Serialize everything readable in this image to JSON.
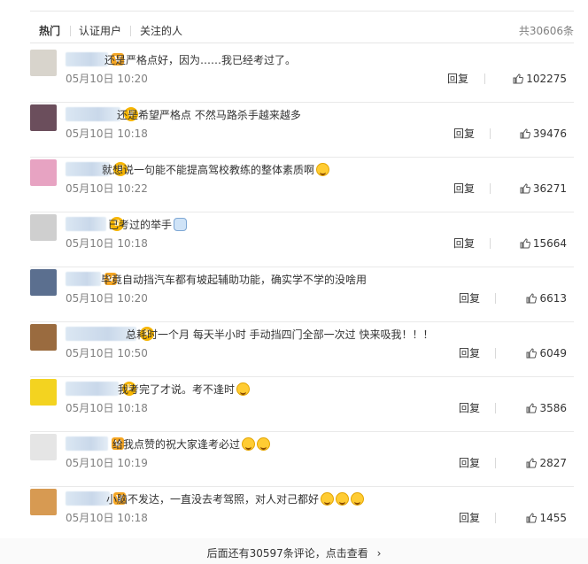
{
  "tabs": {
    "items": [
      {
        "label": "热门",
        "active": true
      },
      {
        "label": "认证用户",
        "active": false
      },
      {
        "label": "关注的人",
        "active": false
      }
    ],
    "total": "共30606条"
  },
  "comments": [
    {
      "badge": "V",
      "text": "还是严格点好，因为……我已经考过了。",
      "emojis": [],
      "time": "05月10日 10:20",
      "reply": "回复",
      "likes": "102275",
      "avatar_color": "#d8d4cc"
    },
    {
      "badge": "crown",
      "text": "还是希望严格点 不然马路杀手越来越多",
      "emojis": [],
      "time": "05月10日 10:18",
      "reply": "回复",
      "likes": "39476",
      "avatar_color": "#6b4e5c"
    },
    {
      "badge": "crown",
      "text": "就想说一句能不能提高驾校教练的整体素质啊",
      "emojis": [
        "crying-emoji"
      ],
      "time": "05月10日 10:22",
      "reply": "回复",
      "likes": "36271",
      "avatar_color": "#e7a3c2"
    },
    {
      "badge": "crown",
      "text": "已考过的举手",
      "emojis": [
        "raised-hand-emoji"
      ],
      "time": "05月10日 10:18",
      "reply": "回复",
      "likes": "15664",
      "avatar_color": "#cfcfcf"
    },
    {
      "badge": "V",
      "text": "毕竟自动挡汽车都有坡起辅助功能，确实学不学的没啥用",
      "emojis": [],
      "time": "05月10日 10:20",
      "reply": "回复",
      "likes": "6613",
      "avatar_color": "#5b6f8f"
    },
    {
      "badge": "crown",
      "text": "总耗时一个月 每天半小时 手动挡四门全部一次过 快来吸我！！！",
      "emojis": [],
      "time": "05月10日 10:50",
      "reply": "回复",
      "likes": "6049",
      "avatar_color": "#9a6b3f"
    },
    {
      "badge": "crown",
      "text": "我考完了才说。考不逢时",
      "emojis": [
        "laughing-emoji"
      ],
      "time": "05月10日 10:18",
      "reply": "回复",
      "likes": "3586",
      "avatar_color": "#f3d320"
    },
    {
      "badge": "V",
      "text": "给我点赞的祝大家逢考必过",
      "emojis": [
        "kiss-emoji",
        "kiss-emoji"
      ],
      "time": "05月10日 10:19",
      "reply": "回复",
      "likes": "2827",
      "avatar_color": "#e5e5e5"
    },
    {
      "badge": "V",
      "text": "小脑不发达，一直没去考驾照，对人对己都好",
      "emojis": [
        "grin-emoji",
        "grin-emoji",
        "grin-emoji"
      ],
      "time": "05月10日 10:18",
      "reply": "回复",
      "likes": "1455",
      "avatar_color": "#d79a52"
    }
  ],
  "more": {
    "label": "后面还有30597条评论，点击查看",
    "arrow": "›"
  },
  "colors": {
    "badge_v": "#f5a623",
    "badge_crown": "#f7b500",
    "muted": "#808080",
    "text": "#333333"
  }
}
